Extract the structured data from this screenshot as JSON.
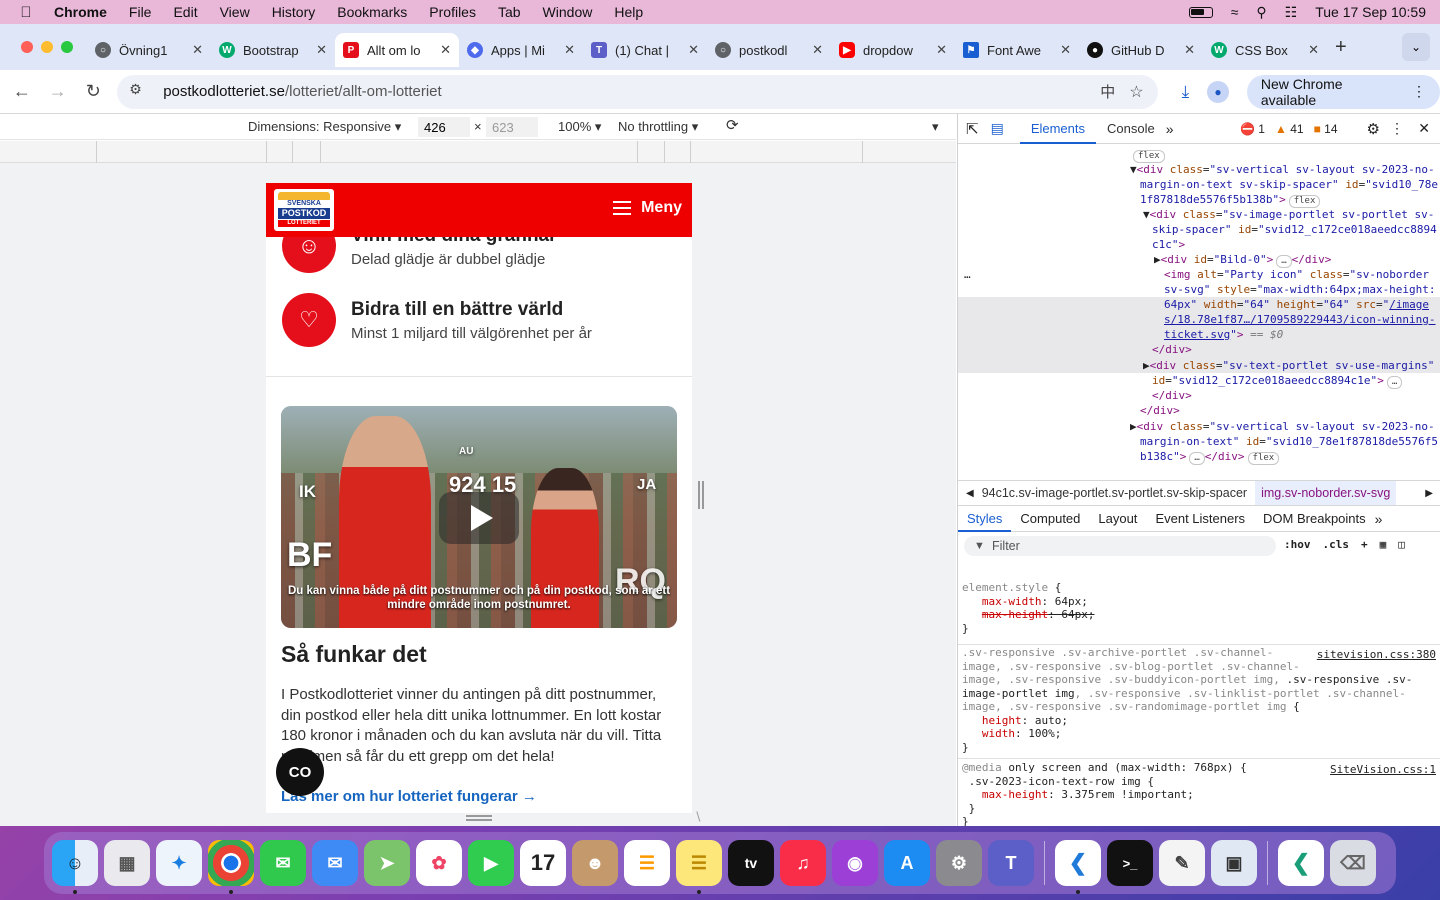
{
  "menubar": {
    "app": "Chrome",
    "items": [
      "File",
      "Edit",
      "View",
      "History",
      "Bookmarks",
      "Profiles",
      "Tab",
      "Window",
      "Help"
    ],
    "datetime": "Tue 17 Sep  10:59"
  },
  "tabs": [
    {
      "title": "Övning1",
      "icon": "globe-icon",
      "color": "#5f6368"
    },
    {
      "title": "Bootstrap",
      "icon": "w-icon",
      "color": "#04aa6d"
    },
    {
      "title": "Allt om lo",
      "icon": "postkod-icon",
      "color": "#e40f1a"
    },
    {
      "title": "Apps | Mi",
      "icon": "apps-icon",
      "color": "#4f6bed"
    },
    {
      "title": "(1) Chat |",
      "icon": "teams-icon",
      "color": "#5b5fc7"
    },
    {
      "title": "postkodl",
      "icon": "globe-icon",
      "color": "#5f6368"
    },
    {
      "title": "dropdow",
      "icon": "youtube-icon",
      "color": "#ff0000"
    },
    {
      "title": "Font Awe",
      "icon": "flag-icon",
      "color": "#1a5fd1"
    },
    {
      "title": "GitHub D",
      "icon": "github-icon",
      "color": "#111111"
    },
    {
      "title": "CSS Box",
      "icon": "w-icon",
      "color": "#04aa6d"
    }
  ],
  "address": {
    "host": "postkodlotteriet.se",
    "path": "/lotteriet/allt-om-lotteriet"
  },
  "toolbar": {
    "new_chrome": "New Chrome available"
  },
  "device": {
    "dimensions_label": "Dimensions: Responsive",
    "width": "426",
    "height": "623",
    "zoom": "100%",
    "throttling": "No throttling",
    "times": "×"
  },
  "site": {
    "logo_lines": [
      "SVENSKA",
      "POSTKOD",
      "LOTTERIET"
    ],
    "menu_label": "Meny",
    "feature1_title": "Vinn med dina grannar",
    "feature1_sub": "Delad glädje är dubbel glädje",
    "feature2_title": "Bidra till en bättre värld",
    "feature2_sub": "Minst 1 miljard till välgörenhet per år",
    "video_codes": [
      "IK",
      "AU",
      "924 15",
      "JA",
      "BF",
      "RQ"
    ],
    "video_subtitle": "Du kan vinna både på ditt postnummer och på din postkod, som är ett mindre område inom postnumret.",
    "section_title": "Så funkar det",
    "section_text": "I Postkodlotteriet vinner du antingen på ditt postnummer, din postkod eller hela ditt unika lottnummer. En lott kostar 180 kronor i månaden och du kan avsluta när du vill. Titta på filmen så får du ett grepp om det hela!",
    "more_link": "Läs mer om hur lotteriet fungerar",
    "chat_label": "CO"
  },
  "devtools": {
    "tabs": [
      "Elements",
      "Console"
    ],
    "errors": "1",
    "warnings": "41",
    "issues": "14",
    "breadcrumb_left": "94c1c.sv-image-portlet.sv-portlet.sv-skip-spacer",
    "breadcrumb_selected": "img.sv-noborder.sv-svg",
    "style_tabs": [
      "Styles",
      "Computed",
      "Layout",
      "Event Listeners",
      "DOM Breakpoints"
    ],
    "filter_placeholder": "Filter",
    "hov": ":hov",
    "cls": ".cls"
  },
  "dock": [
    "Finder",
    "Launchpad",
    "Safari",
    "Chrome",
    "Messages",
    "Mail",
    "Maps",
    "Photos",
    "FaceTime",
    "Calendar",
    "Contacts",
    "Reminders",
    "Notes",
    "Apple TV",
    "Music",
    "Podcasts",
    "App Store",
    "System Settings",
    "Teams",
    "VS Code",
    "Terminal",
    "TextEdit",
    "Preview",
    "VS Code Insiders",
    "Trash"
  ],
  "colors": {
    "brand_red": "#ee0000",
    "link_blue": "#1565c0",
    "devtools_blue": "#1a5fd1"
  }
}
